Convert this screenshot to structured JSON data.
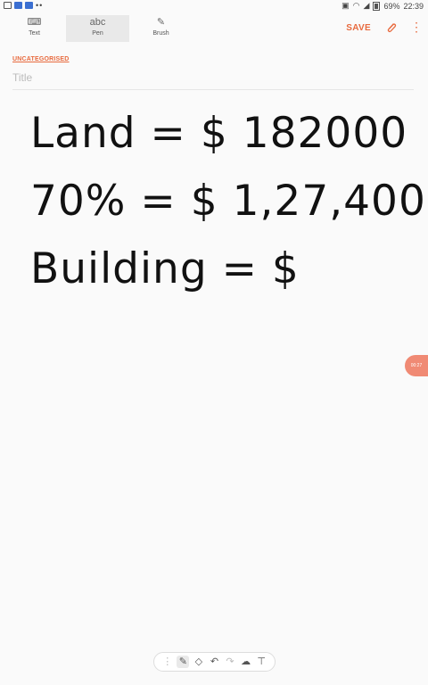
{
  "status_bar": {
    "battery": "69%",
    "time": "22:39"
  },
  "toolbar": {
    "modes": [
      {
        "label": "Text",
        "icon": "keyboard-icon"
      },
      {
        "label": "Pen",
        "icon": "abc",
        "active": true
      },
      {
        "label": "Brush",
        "icon": "brush-icon"
      }
    ],
    "save_label": "SAVE"
  },
  "note": {
    "category": "UNCATEGORISED",
    "title_placeholder": "Title",
    "lines": [
      "Land = $ 182000",
      "70% = $ 1,27,400",
      "Building = $"
    ]
  },
  "record_badge": {
    "time": "00:27"
  },
  "accent_color": "#e86a3e"
}
